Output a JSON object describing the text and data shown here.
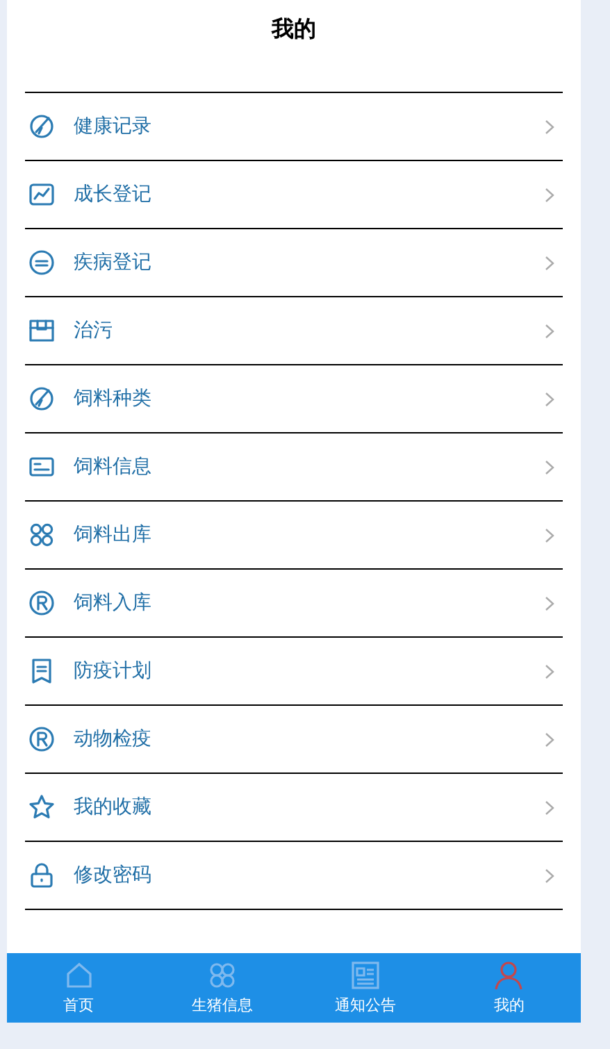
{
  "header": {
    "title": "我的"
  },
  "menu": [
    {
      "label": "健康记录"
    },
    {
      "label": "成长登记"
    },
    {
      "label": "疾病登记"
    },
    {
      "label": "治污"
    },
    {
      "label": "饲料种类"
    },
    {
      "label": "饲料信息"
    },
    {
      "label": "饲料出库"
    },
    {
      "label": "饲料入库"
    },
    {
      "label": "防疫计划"
    },
    {
      "label": "动物检疫"
    },
    {
      "label": "我的收藏"
    },
    {
      "label": "修改密码"
    }
  ],
  "tabs": [
    {
      "label": "首页",
      "selected": false
    },
    {
      "label": "生猪信息",
      "selected": false
    },
    {
      "label": "通知公告",
      "selected": false
    },
    {
      "label": "我的",
      "selected": true
    }
  ]
}
